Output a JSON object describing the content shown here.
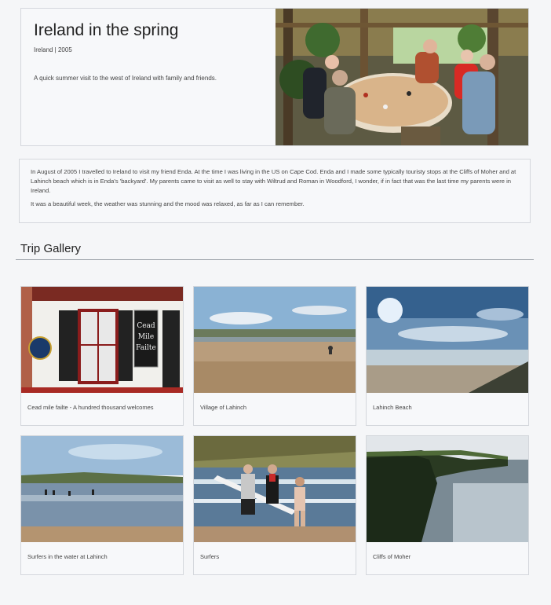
{
  "hero": {
    "title": "Ireland in the spring",
    "meta": "Ireland | 2005",
    "summary": "A quick summer visit to the west of Ireland with family and friends.",
    "photo_alt": "Family and friends dining at an outdoor table"
  },
  "description": {
    "paragraphs": [
      "In August of 2005 I travelled to Ireland to visit my friend Enda. At the time I was living in the US on Cape Cod. Enda and I made some typically touristy stops at the Cliffs of Moher and at Lahinch beach which is in Enda's 'backyard'. My parents came to visit as well to stay with Wiltrud and Roman in Woodford, I wonder, if in fact that was the last time my parents were in Ireland.",
      "It was a beautiful week, the weather was stunning and the mood was relaxed, as far as I can remember."
    ]
  },
  "gallery": {
    "title": "Trip Gallery",
    "items": [
      {
        "caption": "Cead mile failte - A hundred thousand welcomes",
        "sign_text": "Cead Mile Failte"
      },
      {
        "caption": "Village of Lahinch"
      },
      {
        "caption": "Lahinch Beach"
      },
      {
        "caption": "Surfers in the water at Lahinch"
      },
      {
        "caption": "Surfers"
      },
      {
        "caption": "Cliffs of Moher"
      }
    ]
  }
}
